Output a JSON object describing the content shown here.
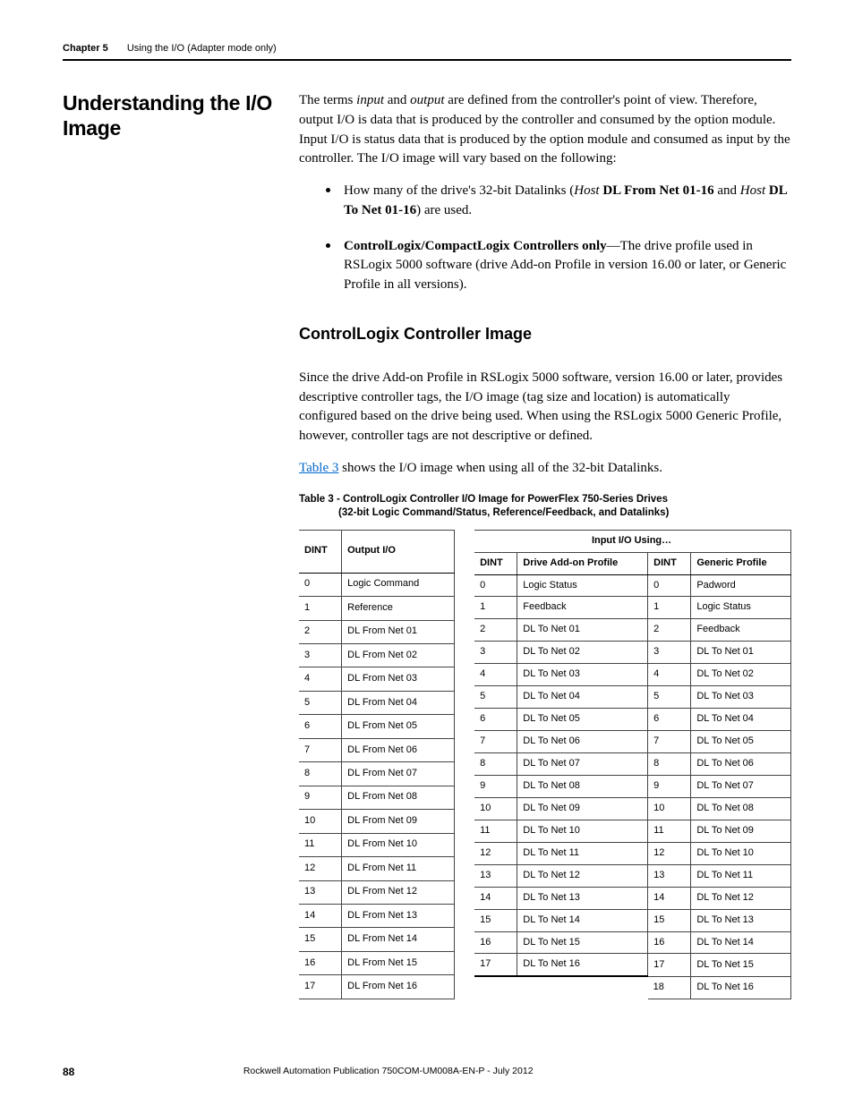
{
  "running_head": {
    "chapter_label": "Chapter 5",
    "chapter_title": "Using the I/O (Adapter mode only)"
  },
  "section_heading": "Understanding the I/O Image",
  "intro_para_html": "The terms <em>input</em> and <em>output</em> are defined from the controller's point of view. Therefore, output I/O is data that is produced by the controller and consumed by the option module. Input I/O is status data that is produced by the option module and consumed as input by the controller. The I/O image will vary based on the following:",
  "bullets": [
    "How many of the drive's 32-bit Datalinks (<em>Host</em> <strong>DL From Net 01-16</strong> and <em>Host</em> <strong>DL To Net 01-16</strong>) are used.",
    "<strong>ControlLogix/CompactLogix Controllers only</strong>—The drive profile used in RSLogix 5000 software (drive Add-on Profile in version 16.00 or later, or Generic Profile in all versions)."
  ],
  "sub_heading": "ControlLogix Controller Image",
  "sub_para": "Since the drive Add-on Profile in RSLogix 5000 software, version 16.00 or later, provides descriptive controller tags, the I/O image (tag size and location) is automatically configured based on the drive being used. When using the RSLogix 5000 Generic Profile, however, controller tags are not descriptive or defined.",
  "link_sentence_prefix": "",
  "link_text": "Table 3",
  "link_sentence_suffix": " shows the I/O image when using all of the 32-bit Datalinks.",
  "table_caption_line1": "Table 3 - ControlLogix Controller I/O Image for PowerFlex 750-Series Drives",
  "table_caption_line2": "(32-bit Logic Command/Status, Reference/Feedback, and Datalinks)",
  "headers": {
    "dint": "DINT",
    "output_io": "Output I/O",
    "input_io_using": "Input I/O Using…",
    "drive_addon": "Drive Add-on Profile",
    "generic": "Generic Profile"
  },
  "output_rows": [
    {
      "dint": "0",
      "label": "Logic Command"
    },
    {
      "dint": "1",
      "label": "Reference"
    },
    {
      "dint": "2",
      "label": "DL From Net 01"
    },
    {
      "dint": "3",
      "label": "DL From Net 02"
    },
    {
      "dint": "4",
      "label": "DL From Net 03"
    },
    {
      "dint": "5",
      "label": "DL From Net 04"
    },
    {
      "dint": "6",
      "label": "DL From Net 05"
    },
    {
      "dint": "7",
      "label": "DL From Net 06"
    },
    {
      "dint": "8",
      "label": "DL From Net 07"
    },
    {
      "dint": "9",
      "label": "DL From Net 08"
    },
    {
      "dint": "10",
      "label": "DL From Net 09"
    },
    {
      "dint": "11",
      "label": "DL From Net 10"
    },
    {
      "dint": "12",
      "label": "DL From Net 11"
    },
    {
      "dint": "13",
      "label": "DL From Net 12"
    },
    {
      "dint": "14",
      "label": "DL From Net 13"
    },
    {
      "dint": "15",
      "label": "DL From Net 14"
    },
    {
      "dint": "16",
      "label": "DL From Net 15"
    },
    {
      "dint": "17",
      "label": "DL From Net 16"
    }
  ],
  "addon_rows": [
    {
      "dint": "0",
      "label": "Logic Status"
    },
    {
      "dint": "1",
      "label": "Feedback"
    },
    {
      "dint": "2",
      "label": "DL To Net 01"
    },
    {
      "dint": "3",
      "label": "DL To Net 02"
    },
    {
      "dint": "4",
      "label": "DL To Net 03"
    },
    {
      "dint": "5",
      "label": "DL To Net 04"
    },
    {
      "dint": "6",
      "label": "DL To Net 05"
    },
    {
      "dint": "7",
      "label": "DL To Net 06"
    },
    {
      "dint": "8",
      "label": "DL To Net 07"
    },
    {
      "dint": "9",
      "label": "DL To Net 08"
    },
    {
      "dint": "10",
      "label": "DL To Net 09"
    },
    {
      "dint": "11",
      "label": "DL To Net 10"
    },
    {
      "dint": "12",
      "label": "DL To Net 11"
    },
    {
      "dint": "13",
      "label": "DL To Net 12"
    },
    {
      "dint": "14",
      "label": "DL To Net 13"
    },
    {
      "dint": "15",
      "label": "DL To Net 14"
    },
    {
      "dint": "16",
      "label": "DL To Net 15"
    },
    {
      "dint": "17",
      "label": "DL To Net 16"
    }
  ],
  "generic_rows": [
    {
      "dint": "0",
      "label": "Padword"
    },
    {
      "dint": "1",
      "label": "Logic Status"
    },
    {
      "dint": "2",
      "label": "Feedback"
    },
    {
      "dint": "3",
      "label": "DL To Net 01"
    },
    {
      "dint": "4",
      "label": "DL To Net 02"
    },
    {
      "dint": "5",
      "label": "DL To Net 03"
    },
    {
      "dint": "6",
      "label": "DL To Net 04"
    },
    {
      "dint": "7",
      "label": "DL To Net 05"
    },
    {
      "dint": "8",
      "label": "DL To Net 06"
    },
    {
      "dint": "9",
      "label": "DL To Net 07"
    },
    {
      "dint": "10",
      "label": "DL To Net 08"
    },
    {
      "dint": "11",
      "label": "DL To Net 09"
    },
    {
      "dint": "12",
      "label": "DL To Net 10"
    },
    {
      "dint": "13",
      "label": "DL To Net 11"
    },
    {
      "dint": "14",
      "label": "DL To Net 12"
    },
    {
      "dint": "15",
      "label": "DL To Net 13"
    },
    {
      "dint": "16",
      "label": "DL To Net 14"
    },
    {
      "dint": "17",
      "label": "DL To Net 15"
    },
    {
      "dint": "18",
      "label": "DL To Net 16"
    }
  ],
  "footer": {
    "page_number": "88",
    "publication": "Rockwell Automation Publication 750COM-UM008A-EN-P - July 2012"
  }
}
